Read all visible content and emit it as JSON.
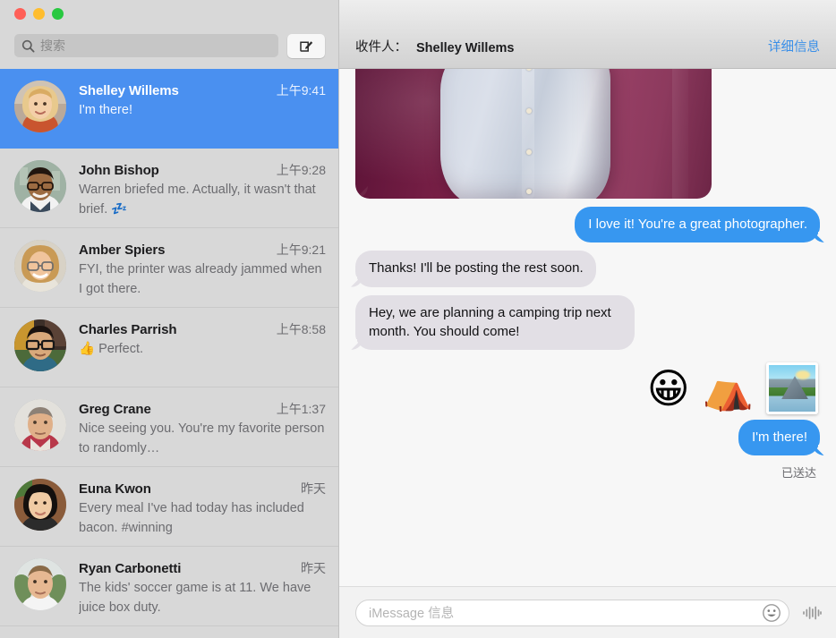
{
  "titlebar": {
    "traffic_lights": [
      {
        "name": "close",
        "color": "#ff5f57"
      },
      {
        "name": "minimize",
        "color": "#ffbd2e"
      },
      {
        "name": "zoom",
        "color": "#28c840"
      }
    ],
    "search_placeholder": "搜索",
    "search_icon": "search-icon",
    "compose_icon": "compose-pencil-icon"
  },
  "sidebar": {
    "conversations": [
      {
        "name": "Shelley Willems",
        "time": "上午9:41",
        "preview": "I'm there!",
        "selected": true,
        "avatar_name": "avatar-shelley-willems"
      },
      {
        "name": "John Bishop",
        "time": "上午9:28",
        "preview": "Warren briefed me. Actually, it wasn't that brief. 💤",
        "selected": false,
        "avatar_name": "avatar-john-bishop"
      },
      {
        "name": "Amber Spiers",
        "time": "上午9:21",
        "preview": "FYI, the printer was already jammed when I got there.",
        "selected": false,
        "avatar_name": "avatar-amber-spiers"
      },
      {
        "name": "Charles Parrish",
        "time": "上午8:58",
        "preview": "👍 Perfect.",
        "selected": false,
        "avatar_name": "avatar-charles-parrish"
      },
      {
        "name": "Greg Crane",
        "time": "上午1:37",
        "preview": "Nice seeing you. You're my favorite person to randomly…",
        "selected": false,
        "avatar_name": "avatar-greg-crane"
      },
      {
        "name": "Euna Kwon",
        "time": "昨天",
        "preview": "Every meal I've had today has included bacon. #winning",
        "selected": false,
        "avatar_name": "avatar-euna-kwon"
      },
      {
        "name": "Ryan Carbonetti",
        "time": "昨天",
        "preview": "The kids' soccer game is at 11. We have juice box duty.",
        "selected": false,
        "avatar_name": "avatar-ryan-carbonetti"
      }
    ]
  },
  "chat_header": {
    "to_label": "收件人：",
    "to_name": "Shelley Willems",
    "details_link": "详细信息"
  },
  "thread": {
    "photo_attachment_alt": "photo of a person in a light shirt on a magenta backdrop",
    "messages": [
      {
        "direction": "out",
        "text": "I love it! You're a great photographer."
      },
      {
        "direction": "in",
        "text": "Thanks! I'll be posting the rest soon."
      },
      {
        "direction": "in",
        "text": "Hey, we are planning a camping trip next month. You should come!"
      },
      {
        "direction": "out",
        "text": "I'm there!"
      }
    ],
    "stickers": [
      {
        "name": "grinning-face-emoji",
        "glyph": "😀"
      },
      {
        "name": "tent-emoji",
        "glyph": "⛺"
      },
      {
        "name": "national-park-photo-emoji",
        "glyph": "🏞"
      }
    ],
    "delivery_status": "已送达"
  },
  "composer": {
    "placeholder": "iMessage 信息",
    "emoji_icon": "smiley-face-icon",
    "audio_icon": "audio-waveform-icon"
  },
  "colors": {
    "accent_blue": "#3797f0",
    "selected_row": "#4a90f0",
    "incoming_bubble": "#e2dfe5",
    "sidebar_bg": "#d8d8d8",
    "thread_bg": "#f7f7f7",
    "link_blue": "#3a8fe8"
  }
}
